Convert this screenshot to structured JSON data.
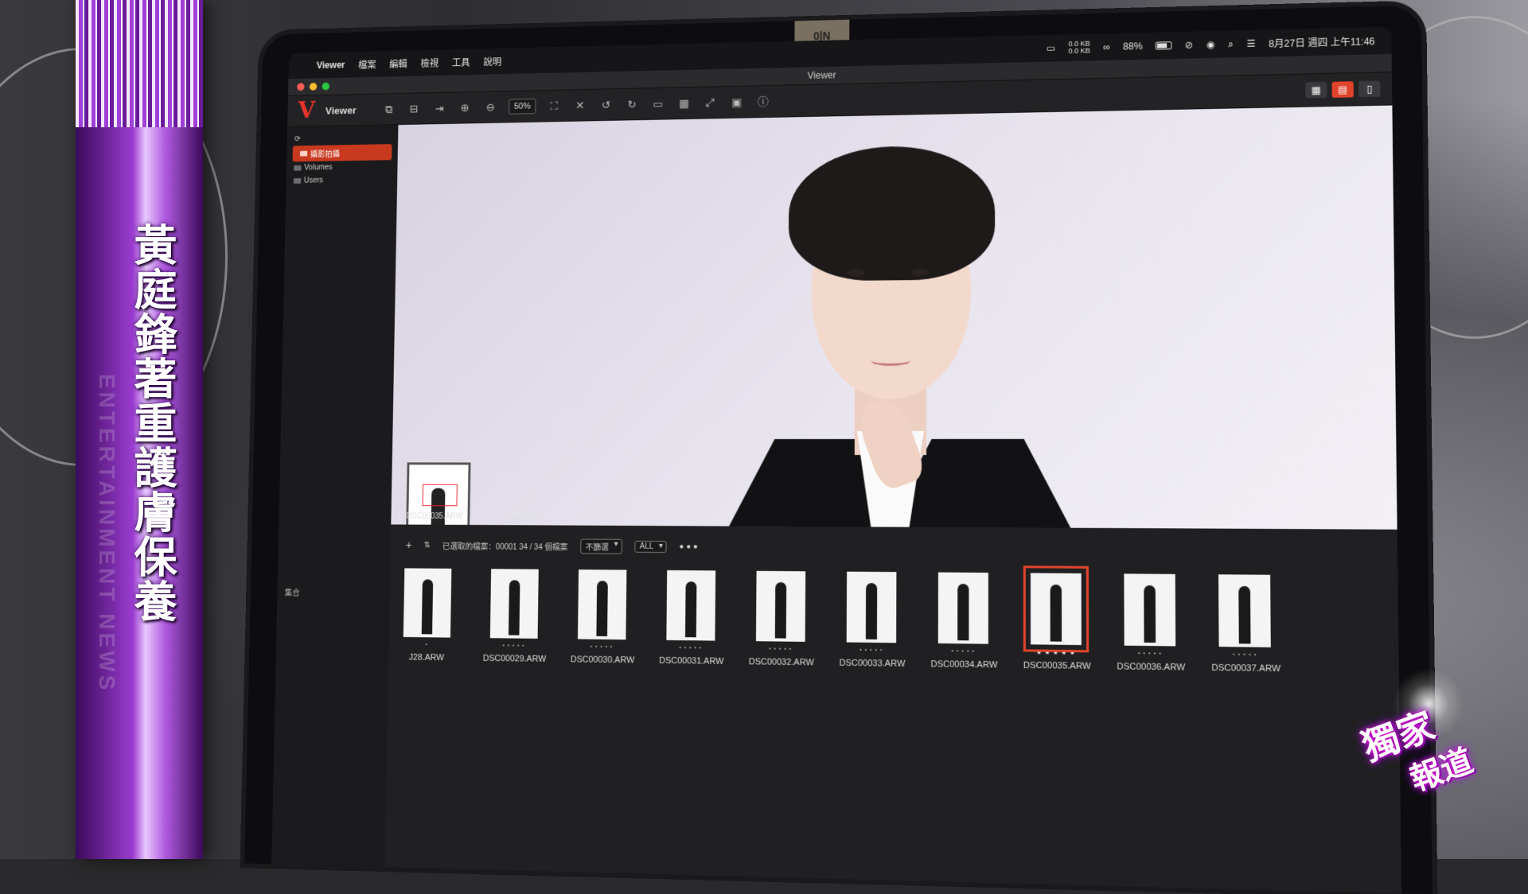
{
  "banner": {
    "title": "黃庭鋒著重護膚保養",
    "sub": "ENTERTAINMENT NEWS"
  },
  "laptop": {
    "notch_label": "0|N"
  },
  "menubar": {
    "app": "Viewer",
    "menus": [
      "檔案",
      "編輯",
      "檢視",
      "工具",
      "說明"
    ],
    "status": {
      "network_up": "0.0 KB",
      "network_down": "0.0 KB",
      "battery": "88%",
      "datetime": "8月27日 週四 上午11:46"
    }
  },
  "window": {
    "title": "Viewer",
    "toolbar": {
      "logo": "V",
      "label": "Viewer",
      "zoom": "50%"
    }
  },
  "sidebar": {
    "items": [
      {
        "label": "攝影拍攝",
        "selected": true
      },
      {
        "label": "Volumes",
        "selected": false
      },
      {
        "label": "Users",
        "selected": false
      }
    ]
  },
  "preview": {
    "filename": "DSC00035.ARW",
    "stars": "★★★★★"
  },
  "filmbar": {
    "collection_label": "集合",
    "add": "+",
    "selection_info": "已選取的檔案：00001  34 / 34 個檔案",
    "filter_dropdown": "不篩選",
    "all_dropdown": "ALL"
  },
  "filmstrip": [
    {
      "name": "J28.ARW",
      "stars": "•",
      "selected": false
    },
    {
      "name": "DSC00029.ARW",
      "stars": "• • • • •",
      "selected": false
    },
    {
      "name": "DSC00030.ARW",
      "stars": "• • • • •",
      "selected": false
    },
    {
      "name": "DSC00031.ARW",
      "stars": "• • • • •",
      "selected": false
    },
    {
      "name": "DSC00032.ARW",
      "stars": "• • • • •",
      "selected": false
    },
    {
      "name": "DSC00033.ARW",
      "stars": "• • • • •",
      "selected": false
    },
    {
      "name": "DSC00034.ARW",
      "stars": "• • • • •",
      "selected": false
    },
    {
      "name": "DSC00035.ARW",
      "stars": "★ ★ ★ ★ ★",
      "selected": true
    },
    {
      "name": "DSC00036.ARW",
      "stars": "• • • • •",
      "selected": false
    },
    {
      "name": "DSC00037.ARW",
      "stars": "• • • • •",
      "selected": false
    }
  ],
  "exclusive": {
    "line1": "獨家",
    "line2": "報道"
  },
  "colors": {
    "accent": "#e0442a",
    "banner_purple": "#9a3cd0"
  }
}
